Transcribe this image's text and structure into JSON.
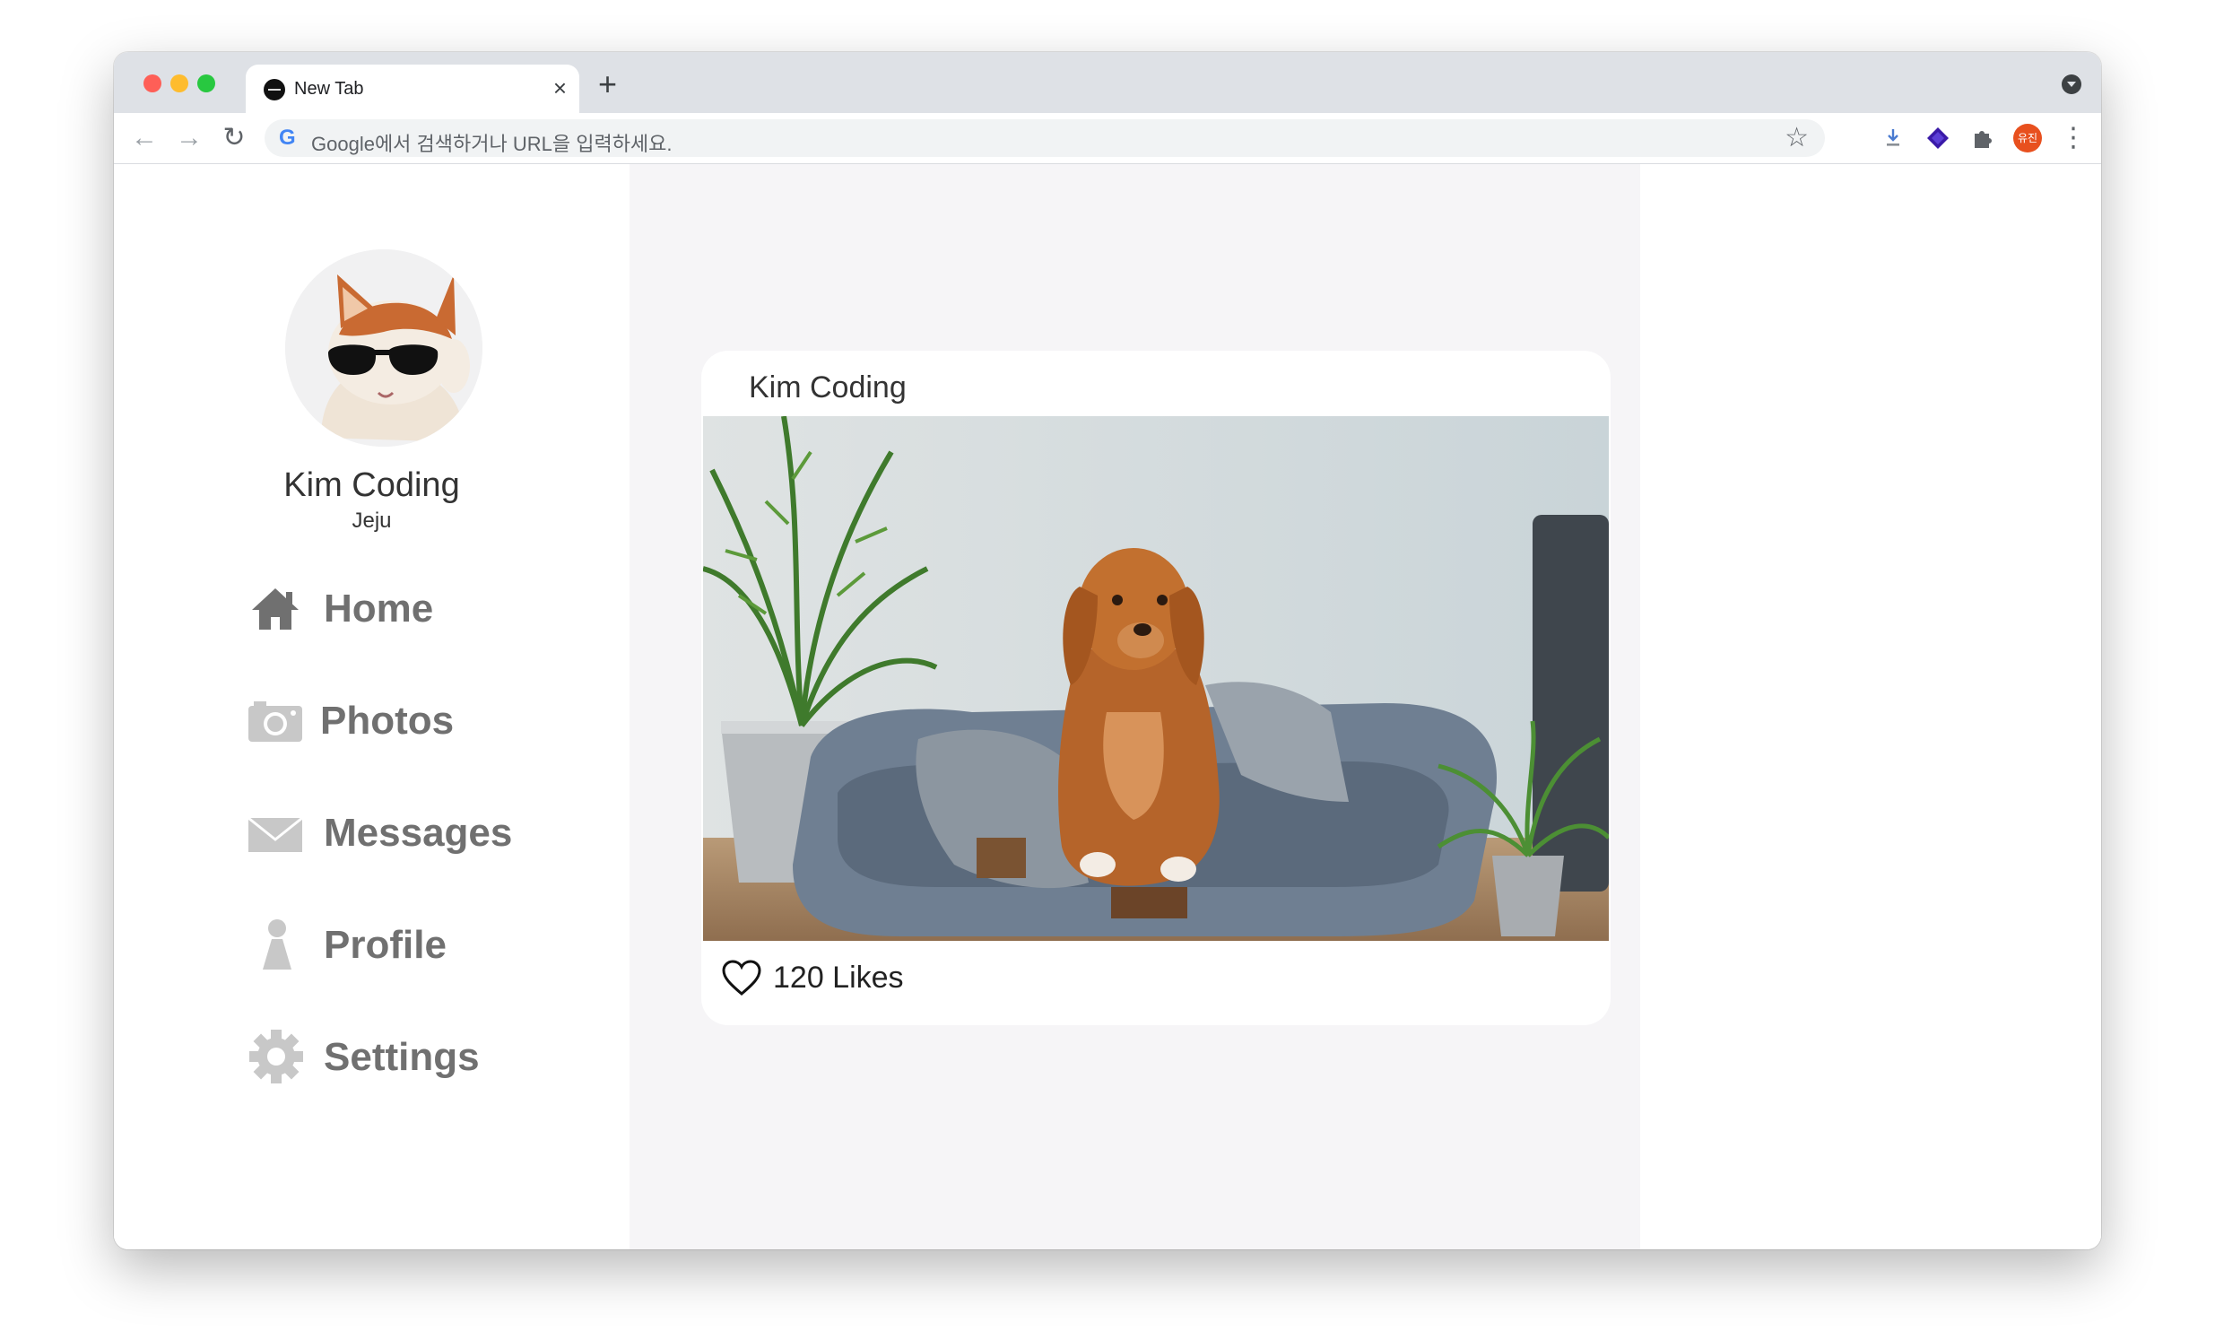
{
  "browser": {
    "tab": {
      "title": "New Tab",
      "close_glyph": "×",
      "favicon": "circle-favicon"
    },
    "new_tab_glyph": "+",
    "nav": {
      "back_glyph": "←",
      "forward_glyph": "→",
      "reload_glyph": "↻"
    },
    "omnibox": {
      "placeholder": "Google에서 검색하거나 URL을 입력하세요.",
      "provider_glyph": "G",
      "bookmark_glyph": "☆"
    },
    "extensions": [
      "download-icon",
      "diamond-extension-icon",
      "puzzle-icon"
    ],
    "profile_avatar_text": "유진",
    "menu_glyph": "⋮"
  },
  "sidebar": {
    "user": {
      "name": "Kim Coding",
      "location": "Jeju",
      "avatar": "cat-with-sunglasses"
    },
    "menu": [
      {
        "label": "Home",
        "icon": "home-icon"
      },
      {
        "label": "Photos",
        "icon": "camera-icon"
      },
      {
        "label": "Messages",
        "icon": "envelope-icon"
      },
      {
        "label": "Profile",
        "icon": "person-icon"
      },
      {
        "label": "Settings",
        "icon": "gear-icon"
      }
    ]
  },
  "post": {
    "author": "Kim Coding",
    "image": "dog-on-pet-bed-photo",
    "likes": "120 Likes",
    "like_icon": "heart-outline-icon"
  },
  "colors": {
    "menu_text": "#707070",
    "main_bg": "#f6f5f7",
    "card_bg": "#ffffff",
    "avatar_badge": "#e8501e"
  }
}
